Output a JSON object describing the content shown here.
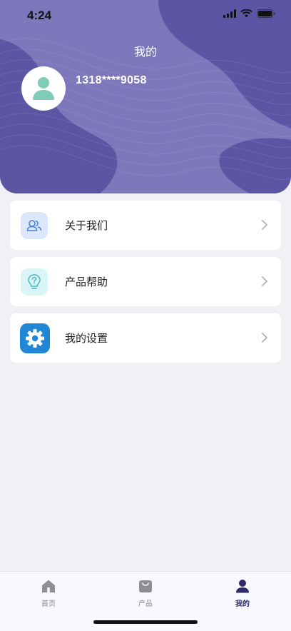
{
  "status_bar": {
    "time": "4:24",
    "icons": [
      "signal-icon",
      "wifi-icon",
      "battery-icon"
    ]
  },
  "header": {
    "title": "我的",
    "phone": "1318****9058",
    "avatar_icon": "user-avatar-icon",
    "bg_color": "#7d77bb",
    "blob_color": "#5c55a4"
  },
  "menu": {
    "items": [
      {
        "label": "关于我们",
        "icon": "users-icon",
        "icon_bg": "#dbe7fb"
      },
      {
        "label": "产品帮助",
        "icon": "lightbulb-question-icon",
        "icon_bg": "#d9f5f7"
      },
      {
        "label": "我的设置",
        "icon": "gear-icon",
        "icon_bg": "#1f87d6"
      }
    ]
  },
  "tabbar": {
    "tabs": [
      {
        "label": "首页",
        "icon": "home-icon",
        "active": false
      },
      {
        "label": "产品",
        "icon": "bag-icon",
        "active": false
      },
      {
        "label": "我的",
        "icon": "person-icon",
        "active": true
      }
    ],
    "active_color": "#2f2a6b"
  }
}
